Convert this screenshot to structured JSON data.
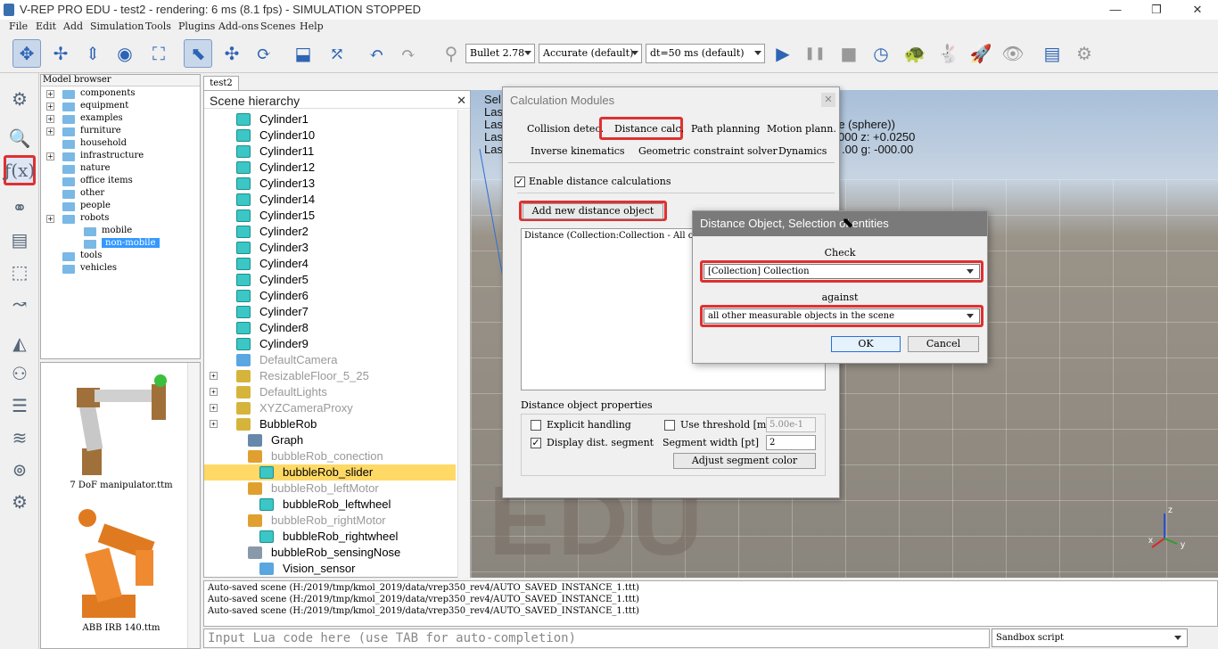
{
  "window": {
    "title": "V-REP PRO EDU - test2 - rendering: 6 ms (8.1 fps) - SIMULATION STOPPED",
    "minimize": "—",
    "restore": "❐",
    "close": "✕"
  },
  "menu": [
    "File",
    "Edit",
    "Add",
    "Simulation",
    "Tools",
    "Plugins",
    "Add-ons",
    "Scenes",
    "Help"
  ],
  "toolbar": {
    "engine": "Bullet 2.78",
    "accuracy": "Accurate (default)",
    "timestep": "dt=50 ms (default)"
  },
  "model_browser": {
    "header": "Model browser",
    "items": [
      {
        "label": "components",
        "expandable": true,
        "indent": 0
      },
      {
        "label": "equipment",
        "expandable": true,
        "indent": 0
      },
      {
        "label": "examples",
        "expandable": true,
        "indent": 0
      },
      {
        "label": "furniture",
        "expandable": true,
        "indent": 0
      },
      {
        "label": "household",
        "expandable": false,
        "indent": 0
      },
      {
        "label": "infrastructure",
        "expandable": true,
        "indent": 0
      },
      {
        "label": "nature",
        "expandable": false,
        "indent": 0
      },
      {
        "label": "office items",
        "expandable": false,
        "indent": 0
      },
      {
        "label": "other",
        "expandable": false,
        "indent": 0
      },
      {
        "label": "people",
        "expandable": false,
        "indent": 0
      },
      {
        "label": "robots",
        "expandable": true,
        "indent": 0
      },
      {
        "label": "mobile",
        "expandable": false,
        "indent": 1
      },
      {
        "label": "non-mobile",
        "expandable": false,
        "indent": 1,
        "selected": true
      },
      {
        "label": "tools",
        "expandable": false,
        "indent": 0
      },
      {
        "label": "vehicles",
        "expandable": false,
        "indent": 0
      }
    ],
    "thumbnails": [
      "7 DoF manipulator.ttm",
      "ABB IRB 140.ttm"
    ]
  },
  "scene_tab": "test2",
  "scene_hierarchy": {
    "header": "Scene hierarchy",
    "items": [
      {
        "label": "Cylinder1",
        "icon": "cube"
      },
      {
        "label": "Cylinder10",
        "icon": "cube"
      },
      {
        "label": "Cylinder11",
        "icon": "cube"
      },
      {
        "label": "Cylinder12",
        "icon": "cube"
      },
      {
        "label": "Cylinder13",
        "icon": "cube"
      },
      {
        "label": "Cylinder14",
        "icon": "cube"
      },
      {
        "label": "Cylinder15",
        "icon": "cube"
      },
      {
        "label": "Cylinder2",
        "icon": "cube"
      },
      {
        "label": "Cylinder3",
        "icon": "cube"
      },
      {
        "label": "Cylinder4",
        "icon": "cube"
      },
      {
        "label": "Cylinder5",
        "icon": "cube"
      },
      {
        "label": "Cylinder6",
        "icon": "cube"
      },
      {
        "label": "Cylinder7",
        "icon": "cube"
      },
      {
        "label": "Cylinder8",
        "icon": "cube"
      },
      {
        "label": "Cylinder9",
        "icon": "cube"
      },
      {
        "label": "DefaultCamera",
        "icon": "camera",
        "dim": true
      },
      {
        "label": "ResizableFloor_5_25",
        "icon": "model",
        "dim": true,
        "plus": true
      },
      {
        "label": "DefaultLights",
        "icon": "model",
        "dim": true,
        "plus": true
      },
      {
        "label": "XYZCameraProxy",
        "icon": "model",
        "dim": true,
        "plus": true
      },
      {
        "label": "BubbleRob",
        "icon": "model",
        "plus": true
      },
      {
        "label": "Graph",
        "icon": "graph",
        "indent": 1
      },
      {
        "label": "bubbleRob_conection",
        "icon": "joint",
        "indent": 1,
        "dim": true
      },
      {
        "label": "bubbleRob_slider",
        "icon": "cube",
        "indent": 2,
        "selected": true
      },
      {
        "label": "bubbleRob_leftMotor",
        "icon": "joint",
        "indent": 1,
        "dim": true
      },
      {
        "label": "bubbleRob_leftwheel",
        "icon": "cube",
        "indent": 2
      },
      {
        "label": "bubbleRob_rightMotor",
        "icon": "joint",
        "indent": 1,
        "dim": true
      },
      {
        "label": "bubbleRob_rightwheel",
        "icon": "cube",
        "indent": 2
      },
      {
        "label": "bubbleRob_sensingNose",
        "icon": "sensor",
        "indent": 1
      },
      {
        "label": "Vision_sensor",
        "icon": "vision",
        "indent": 2
      }
    ]
  },
  "viewport": {
    "watermark": "EDU",
    "info_lines": [
      "Sel",
      "Las",
      "Las",
      "Las",
      "Las"
    ],
    "info_right_1": "re (sphere))",
    "info_right_2": "000   z: +0.0250",
    "info_right_3": ".00   g: -000.00",
    "axis_z": "z",
    "axis_x": "x",
    "axis_y": "y"
  },
  "calc_modules": {
    "title": "Calculation Modules",
    "close": "✕",
    "tabs_row1": [
      "Collision detec.",
      "Distance calc.",
      "Path planning",
      "Motion plann."
    ],
    "tabs_row2": [
      "Inverse kinematics",
      "Geometric constraint solver",
      "Dynamics"
    ],
    "enable_label": "Enable distance calculations",
    "enable_checked": true,
    "add_button": "Add new distance object",
    "list_item": "Distance (Collection:Collection - All other e",
    "props_header": "Distance object properties",
    "explicit_label": "Explicit handling",
    "threshold_label": "Use threshold [m]",
    "threshold_value": "5.00e-1",
    "display_label": "Display dist. segment",
    "segwidth_label": "Segment width [pt]",
    "segwidth_value": "2",
    "adjust_button": "Adjust segment color"
  },
  "dist_object": {
    "title": "Distance Object, Selection of entities",
    "check_label": "Check",
    "check_value": "[Collection] Collection",
    "against_label": "against",
    "against_value": "all other measurable objects in the scene",
    "ok": "OK",
    "cancel": "Cancel"
  },
  "console": {
    "lines": [
      "Auto-saved scene (H:/2019/tmp/kmol_2019/data/vrep350_rev4/AUTO_SAVED_INSTANCE_1.ttt)",
      "Auto-saved scene (H:/2019/tmp/kmol_2019/data/vrep350_rev4/AUTO_SAVED_INSTANCE_1.ttt)",
      "Auto-saved scene (H:/2019/tmp/kmol_2019/data/vrep350_rev4/AUTO_SAVED_INSTANCE_1.ttt)"
    ]
  },
  "lua_input": {
    "placeholder": "Input Lua code here (use TAB for auto-completion)"
  },
  "script_select": "Sandbox script",
  "icons": {
    "play": "▶",
    "pause": "❚❚",
    "stop": "■",
    "undo": "↶",
    "redo": "↷"
  }
}
